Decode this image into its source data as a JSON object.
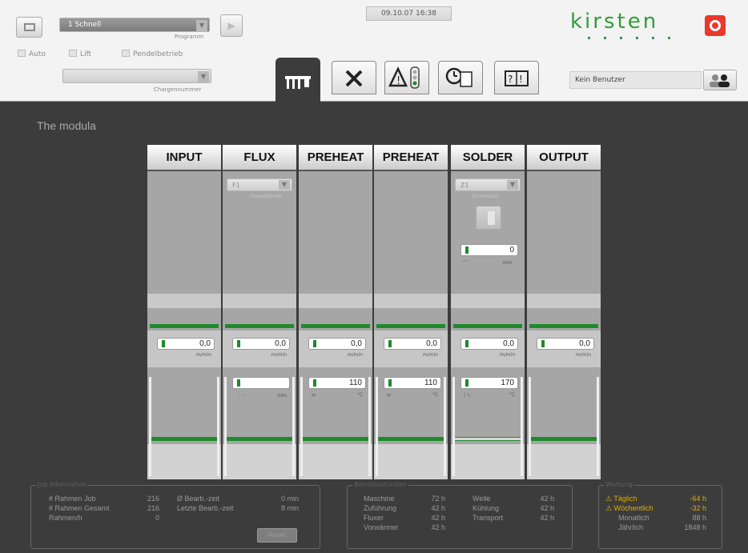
{
  "header": {
    "datetime": "09.10.07 16:38",
    "program_value": "1 Schnell",
    "program_caption": "Programm",
    "batch_caption": "Chargennummer",
    "batch_value": "",
    "auto_label": "Auto",
    "lift_label": "Lift",
    "shuttle_label": "Pendelbetrieb",
    "user_value": "Kein Benutzer",
    "brand": "kirsten"
  },
  "tabs": [
    {
      "label": "modules"
    },
    {
      "label": "tools"
    },
    {
      "label": "alarms"
    },
    {
      "label": "time-log"
    },
    {
      "label": "help"
    }
  ],
  "section_title": "The modula",
  "modules": [
    {
      "name": "INPUT",
      "speed": "0,0",
      "speed_unit": "m/min"
    },
    {
      "name": "FLUX",
      "selector": "F1",
      "selector_caption": "Fluxerbetrieb",
      "speed": "0,0",
      "speed_unit": "m/min",
      "setval": "",
      "setval_unit": "mm"
    },
    {
      "name": "PREHEAT",
      "speed": "0,0",
      "speed_unit": "m/min",
      "temp": "110",
      "temp_unit": "°C"
    },
    {
      "name": "PREHEAT",
      "speed": "0,0",
      "speed_unit": "m/min",
      "temp": "110",
      "temp_unit": "°C"
    },
    {
      "name": "SOLDER",
      "selector": "Z1",
      "selector_caption": "Zinnmodus",
      "wave": "0",
      "wave_unit": "mm",
      "speed": "0,0",
      "speed_unit": "m/min",
      "temp": "170",
      "temp_unit": "°C"
    },
    {
      "name": "OUTPUT",
      "speed": "0,0",
      "speed_unit": "m/min"
    }
  ],
  "job": {
    "title": "Job Information",
    "rows": [
      {
        "label": "# Rahmen Job",
        "value": "216"
      },
      {
        "label": "# Rahmen Gesamt",
        "value": "216"
      },
      {
        "label": "Rahmen/h",
        "value": "0"
      }
    ],
    "rows2": [
      {
        "label": "Ø Bearb.-zeit",
        "value": "0 min"
      },
      {
        "label": "Letzte Bearb.-zeit",
        "value": "8 min"
      }
    ],
    "reset_label": "Reset"
  },
  "hours": {
    "title": "Betriebsstunden",
    "col1": [
      {
        "label": "Maschine",
        "value": "72 h"
      },
      {
        "label": "Zuführung",
        "value": "42 h"
      },
      {
        "label": "Fluxer",
        "value": "42 h"
      },
      {
        "label": "Vorwärmer",
        "value": "42 h"
      }
    ],
    "col2": [
      {
        "label": "Welle",
        "value": "42 h"
      },
      {
        "label": "Kühlung",
        "value": "42 h"
      },
      {
        "label": "Transport",
        "value": "42 h"
      }
    ]
  },
  "maint": {
    "title": "Wartung",
    "rows": [
      {
        "label": "Täglich",
        "value": "-64 h",
        "warn": true
      },
      {
        "label": "Wöchentlich",
        "value": "-32 h",
        "warn": true
      },
      {
        "label": "Monatlich",
        "value": "88 h",
        "warn": false
      },
      {
        "label": "Jährlich",
        "value": "1848 h",
        "warn": false
      }
    ]
  },
  "colors": {
    "accent_green": "#1e8a2c",
    "brand_green": "#2e9e3a",
    "record_red": "#e8392c",
    "warn_yellow": "#e0b000"
  }
}
